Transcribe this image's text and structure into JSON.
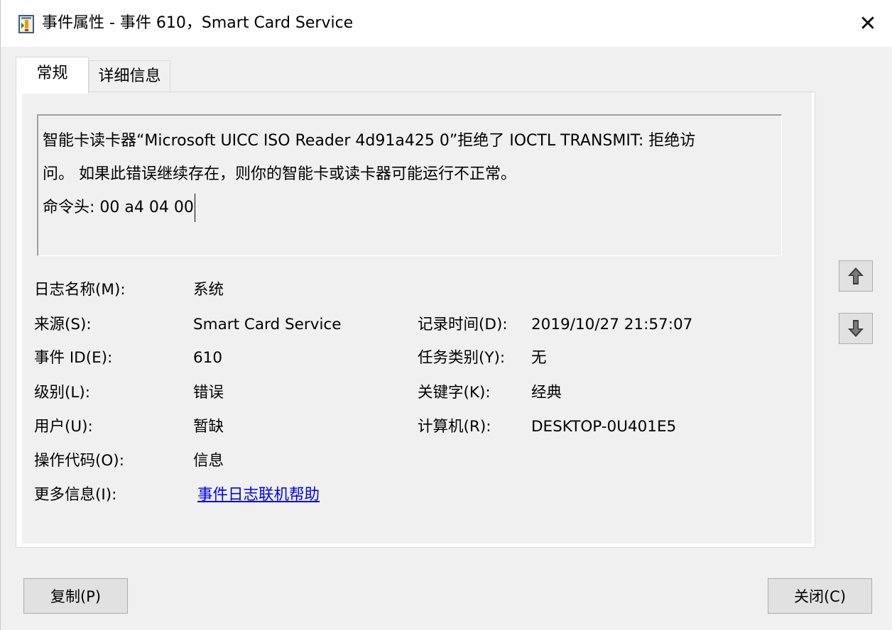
{
  "window": {
    "title": "事件属性 - 事件 610，Smart Card Service",
    "close_symbol": "✕"
  },
  "tabs": [
    {
      "label": "常规",
      "active": true
    },
    {
      "label": "详细信息",
      "active": false
    }
  ],
  "description": {
    "line1": "智能卡读卡器“Microsoft UICC ISO Reader 4d91a425 0”拒绝了 IOCTL TRANSMIT: 拒绝访",
    "line2": "问。 如果此错误继续存在，则你的智能卡或读卡器可能运行不正常。",
    "line3": "",
    "line4": "命令头: 00 a4 04 00"
  },
  "fields": {
    "log_name": {
      "label": "日志名称(M):",
      "value": "系统"
    },
    "source": {
      "label": "来源(S):",
      "value": "Smart Card Service"
    },
    "logged": {
      "label": "记录时间(D):",
      "value": "2019/10/27 21:57:07"
    },
    "event_id": {
      "label": "事件 ID(E):",
      "value": "610"
    },
    "task_category": {
      "label": "任务类别(Y):",
      "value": "无"
    },
    "level": {
      "label": "级别(L):",
      "value": "错误"
    },
    "keywords": {
      "label": "关键字(K):",
      "value": "经典"
    },
    "user": {
      "label": "用户(U):",
      "value": "暂缺"
    },
    "computer": {
      "label": "计算机(R):",
      "value": "DESKTOP-0U401E5"
    },
    "opcode": {
      "label": "操作代码(O):",
      "value": "信息"
    },
    "more_info": {
      "label": "更多信息(I):",
      "value": "事件日志联机帮助"
    }
  },
  "buttons": {
    "copy": "复制(P)",
    "close": "关闭(C)"
  },
  "colors": {
    "link": "#0000ee",
    "background": "#f0f0f0",
    "button": "#e1e1e1"
  }
}
